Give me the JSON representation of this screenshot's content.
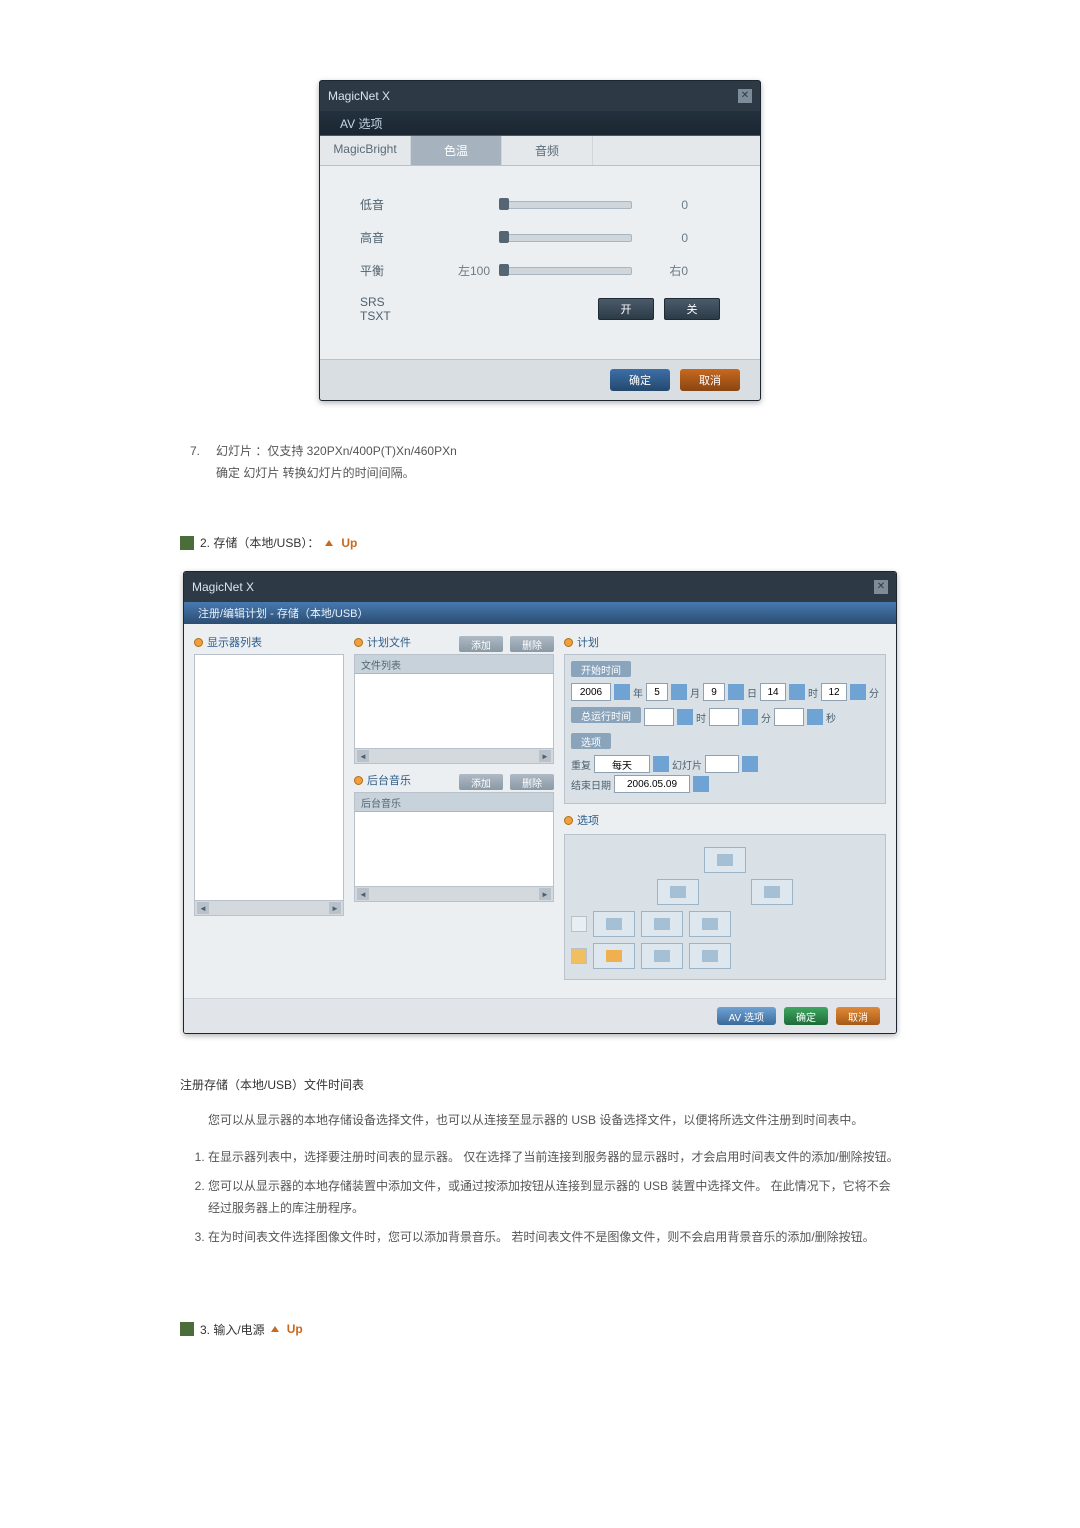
{
  "dialog1": {
    "brand": "MagicNet X",
    "subtitle": "AV 选项",
    "tabs": {
      "magicbright": "MagicBright",
      "colortemp": "色温",
      "audio": "音频"
    },
    "rows": {
      "bass_label": "低音",
      "bass_value": "0",
      "treble_label": "高音",
      "treble_value": "0",
      "balance_label": "平衡",
      "balance_left": "左100",
      "balance_right": "右0",
      "srs_label": "SRS TSXT",
      "on": "开",
      "off": "关"
    },
    "footer": {
      "ok": "确定",
      "cancel": "取消"
    }
  },
  "slide_text": {
    "num": "7.",
    "line1": "幻灯片 ：仅支持 320PXn/400P(T)Xn/460PXn",
    "line2": "确定 幻灯片 转换幻灯片的时间间隔。"
  },
  "section2_head": {
    "num_label": "2. 存储（本地/USB）：",
    "up": "Up"
  },
  "dialog2": {
    "brand": "MagicNet X",
    "crumb": "注册/编辑计划 - 存储（本地/USB）",
    "left": {
      "title": "显示器列表"
    },
    "mid": {
      "files_title": "计划文件",
      "add": "添加",
      "del": "删除",
      "files_head": "文件列表",
      "music_title": "后台音乐",
      "music_head": "后台音乐"
    },
    "right": {
      "plan_title": "计划",
      "start_group": "开始时间",
      "year_val": "2006",
      "year_u": "年",
      "month_val": "5",
      "month_u": "月",
      "day_val": "9",
      "day_u": "日",
      "hour_val": "14",
      "hour_u": "时",
      "min_val": "12",
      "min_u": "分",
      "run_group": "总运行时间",
      "run_h": "时",
      "run_m": "分",
      "run_s": "秒",
      "opt_group": "选项",
      "repeat_label": "重复",
      "repeat_val": "每天",
      "slide_label": "幻灯片",
      "end_label": "结束日期",
      "end_val": "2006.05.09",
      "layout_title": "选项"
    },
    "footer": {
      "av": "AV 选项",
      "ok": "确定",
      "cancel": "取消"
    }
  },
  "para": {
    "heading": "注册存储（本地/USB）文件时间表",
    "intro": "您可以从显示器的本地存储设备选择文件，也可以从连接至显示器的 USB 设备选择文件，以便将所选文件注册到时间表中。",
    "li1": "在显示器列表中，选择要注册时间表的显示器。 仅在选择了当前连接到服务器的显示器时，才会启用时间表文件的添加/删除按钮。",
    "li2": "您可以从显示器的本地存储装置中添加文件，或通过按添加按钮从连接到显示器的 USB 装置中选择文件。 在此情况下，它将不会经过服务器上的库注册程序。",
    "li3": "在为时间表文件选择图像文件时，您可以添加背景音乐。 若时间表文件不是图像文件，则不会启用背景音乐的添加/删除按钮。"
  },
  "section3_head": {
    "num_label": "3. 输入/电源",
    "up": "Up"
  }
}
